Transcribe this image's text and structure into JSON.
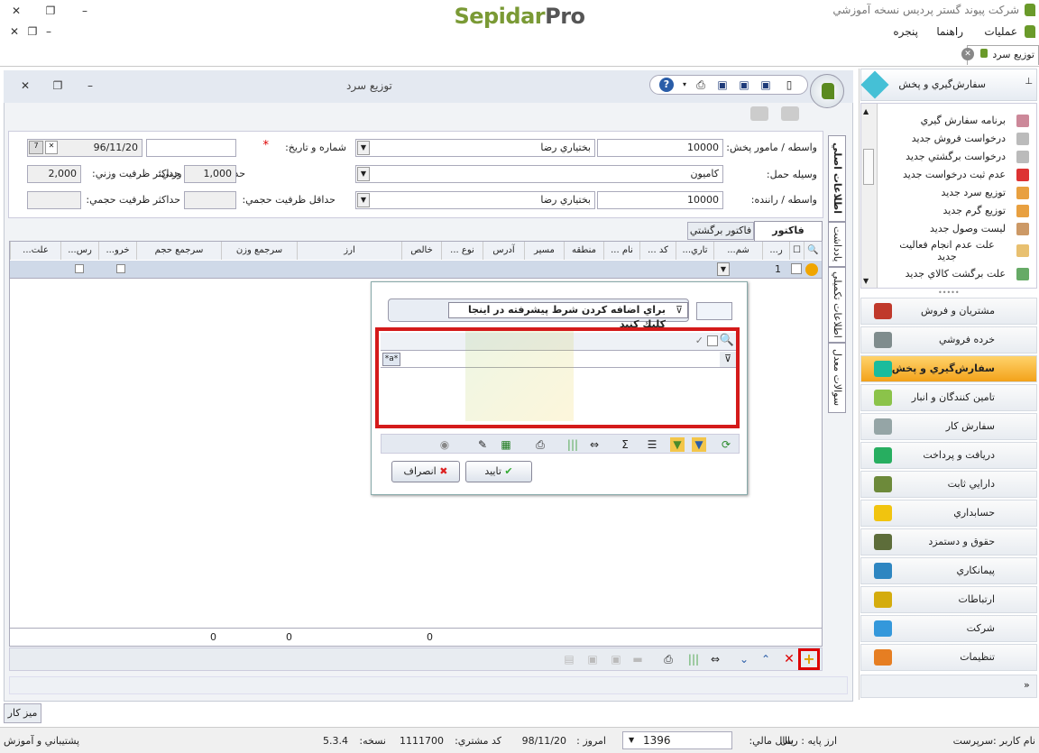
{
  "window": {
    "title": "شرکت پيوند گستر پرديس نسخه آموزشي",
    "logo_a": "Sepidar",
    "logo_b": "Pro"
  },
  "menu": {
    "items": [
      "عمليات",
      "راهنما",
      "پنجره"
    ]
  },
  "doc_tab": {
    "label": "توزيع سرد"
  },
  "doc": {
    "title": "توزيع سرد",
    "form": {
      "agent_label": "واسطه / مامور پخش:",
      "agent_code": "10000",
      "agent_name": "بختياري رضا",
      "number_label": "شماره و تاريخ:",
      "required_mark": "*",
      "number_value": "",
      "date_value": "96/11/20",
      "vehicle_label": "وسيله حمل:",
      "vehicle_value": "کاميون",
      "min_weight_label": "حداقل ظرفيت وزني:",
      "min_weight_value": "1,000",
      "max_weight_label": "حداکثر ظرفيت وزني:",
      "max_weight_value": "2,000",
      "driver_label": "واسطه / راننده:",
      "driver_code": "10000",
      "driver_name": "بختياري رضا",
      "min_volume_label": "حداقل ظرفيت حجمي:",
      "min_volume_value": "",
      "max_volume_label": "حداکثر ظرفيت حجمي:",
      "max_volume_value": ""
    },
    "side_tabs": [
      "اطلاعات اصلي",
      "يادداشت",
      "اطلاعات تکميلي",
      "سوالات معدل"
    ],
    "sub_tabs": [
      "فاکتور فروش",
      "فاکتور برگشتي"
    ],
    "columns": [
      "ر...",
      "شم...",
      "تاري...",
      "کد ...",
      "نام ...",
      "منطقه",
      "مسير",
      "آدرس",
      "نوع ...",
      "خالص",
      "ارز",
      "سرجمع وزن",
      "سرجمع حجم",
      "خرو...",
      "رس...",
      "علت..."
    ],
    "row": {
      "num": "1"
    },
    "footer_totals": [
      "0",
      "0",
      "0"
    ]
  },
  "popup": {
    "advanced_filter": "براي اضافه كردن شرط پيشرفته در اينجا كليك كنيد",
    "ok": "تاييد",
    "cancel": "انصراف",
    "filter_symbol": "*a*"
  },
  "desktop_button": "ميز كار",
  "quick_list": {
    "header": "سفارش‌گيري و پخش",
    "items": [
      "برنامه سفارش گيري",
      "درخواست فروش جديد",
      "درخواست برگشتي جديد",
      "عدم ثبت درخواست جديد",
      "توزيع سرد جديد",
      "توزيع گرم جديد",
      "ليست وصول جديد",
      "علت عدم انجام فعاليت جديد",
      "علت برگشت کالاي جديد"
    ]
  },
  "nav": {
    "items": [
      {
        "label": "مشتريان و فروش",
        "color": "#c0392b"
      },
      {
        "label": "خرده فروشي",
        "color": "#7f8c8d"
      },
      {
        "label": "سفارش‌گيري و پخش",
        "color": "#1abc9c"
      },
      {
        "label": "تامين كنندگان و انبار",
        "color": "#8bc34a"
      },
      {
        "label": "سفارش كار",
        "color": "#95a5a6"
      },
      {
        "label": "دريافت و پرداخت",
        "color": "#27ae60"
      },
      {
        "label": "دارايي ثابت",
        "color": "#6d8a3a"
      },
      {
        "label": "حسابداري",
        "color": "#f1c40f"
      },
      {
        "label": "حقوق و دستمزد",
        "color": "#5d6d3a"
      },
      {
        "label": "پيمانكاري",
        "color": "#2e86c1"
      },
      {
        "label": "ارتباطات",
        "color": "#d4ac0d"
      },
      {
        "label": "شركت",
        "color": "#3498db"
      },
      {
        "label": "تنظيمات",
        "color": "#e67e22"
      }
    ]
  },
  "status": {
    "user": "نام كاربر :سرپرست",
    "currency": "ارز پايه : ريال",
    "fiscal_year_label": "سال مالي:",
    "fiscal_year": "1396",
    "today_label": "امروز :",
    "today": "98/11/20",
    "customer_code_label": "كد مشتري:",
    "customer_code": "1111700",
    "version_label": "نسخه:",
    "version": "5.3.4",
    "support": "پشتيباني و آموزش"
  }
}
